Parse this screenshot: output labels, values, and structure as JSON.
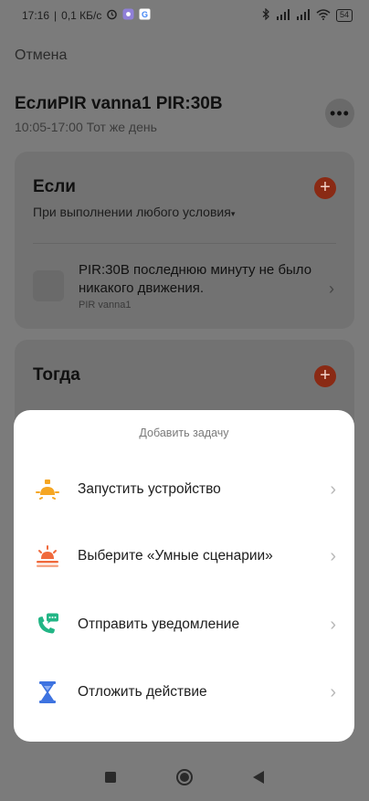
{
  "status_bar": {
    "time": "17:16",
    "speed": "0,1 КБ/с",
    "battery": "54"
  },
  "screen": {
    "cancel": "Отмена",
    "title": "ЕслиPIR vanna1 PIR:30B",
    "time_range": "10:05-17:00 Тот же день",
    "more_icon": "more-icon",
    "if_card": {
      "heading": "Если",
      "condition_mode": "При выполнении любого условия",
      "device_text": "PIR:30B последнюю минуту не было никакого движения.",
      "device_name": "PIR vanna1"
    },
    "then_card": {
      "heading": "Тогда"
    }
  },
  "sheet": {
    "title": "Добавить задачу",
    "items": [
      {
        "label": "Запустить устройство",
        "icon": "bulb-icon"
      },
      {
        "label": "Выберите «Умные сценарии»",
        "icon": "sunrise-icon"
      },
      {
        "label": "Отправить уведомление",
        "icon": "phone-message-icon"
      },
      {
        "label": "Отложить действие",
        "icon": "hourglass-icon"
      }
    ]
  },
  "colors": {
    "accent_orange": "#f5a623",
    "accent_red_orange": "#f06a3c",
    "accent_green": "#22b585",
    "accent_blue": "#3e73e0",
    "plus_button": "#8a2a14"
  }
}
